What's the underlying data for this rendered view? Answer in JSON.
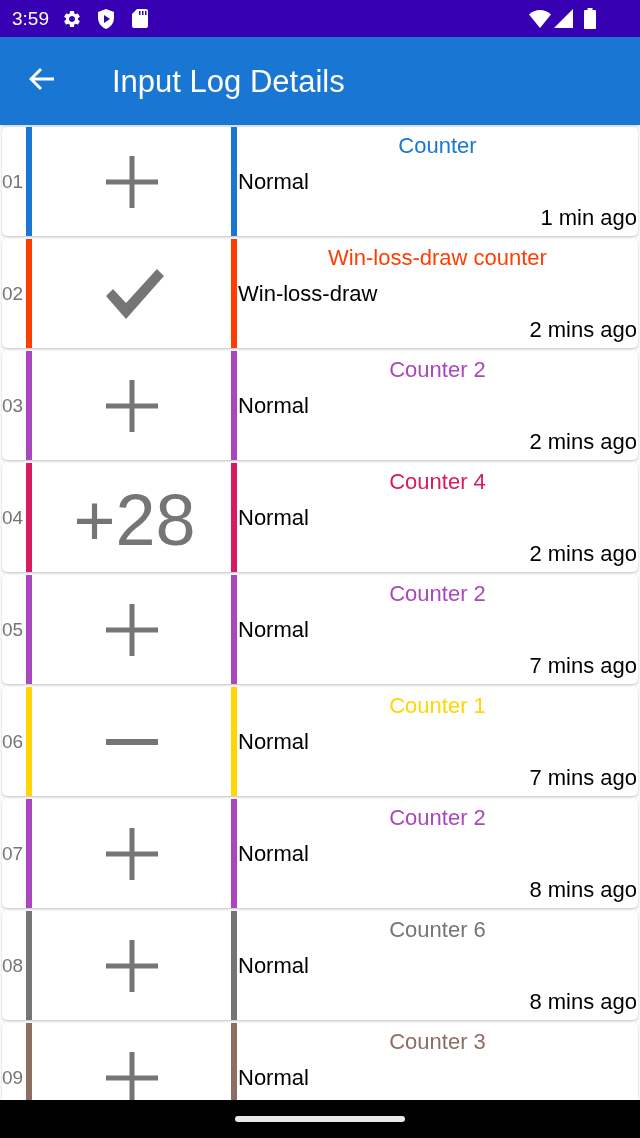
{
  "status_bar": {
    "time": "3:59"
  },
  "app_bar": {
    "title": "Input Log Details"
  },
  "entries": [
    {
      "number": "01",
      "kind": "plus",
      "color": "#1976d2",
      "counter": "Counter",
      "type": "Normal",
      "time": "1 min ago"
    },
    {
      "number": "02",
      "kind": "check",
      "color": "#ff3d00",
      "counter": "Win-loss-draw counter",
      "type": "Win-loss-draw",
      "time": "2 mins ago"
    },
    {
      "number": "03",
      "kind": "plus",
      "color": "#ab47bc",
      "counter": "Counter 2",
      "type": "Normal",
      "time": "2 mins ago"
    },
    {
      "number": "04",
      "kind": "value",
      "value": "+28",
      "color": "#d81b60",
      "counter": "Counter 4",
      "type": "Normal",
      "time": "2 mins ago"
    },
    {
      "number": "05",
      "kind": "plus",
      "color": "#ab47bc",
      "counter": "Counter 2",
      "type": "Normal",
      "time": "7 mins ago"
    },
    {
      "number": "06",
      "kind": "minus",
      "color": "#ffd600",
      "counter": "Counter 1",
      "type": "Normal",
      "time": "7 mins ago"
    },
    {
      "number": "07",
      "kind": "plus",
      "color": "#ab47bc",
      "counter": "Counter 2",
      "type": "Normal",
      "time": "8 mins ago"
    },
    {
      "number": "08",
      "kind": "plus",
      "color": "#757575",
      "counter": "Counter 6",
      "type": "Normal",
      "time": "8 mins ago"
    },
    {
      "number": "09",
      "kind": "plus",
      "color": "#8d6e63",
      "counter": "Counter 3",
      "type": "Normal"
    }
  ]
}
